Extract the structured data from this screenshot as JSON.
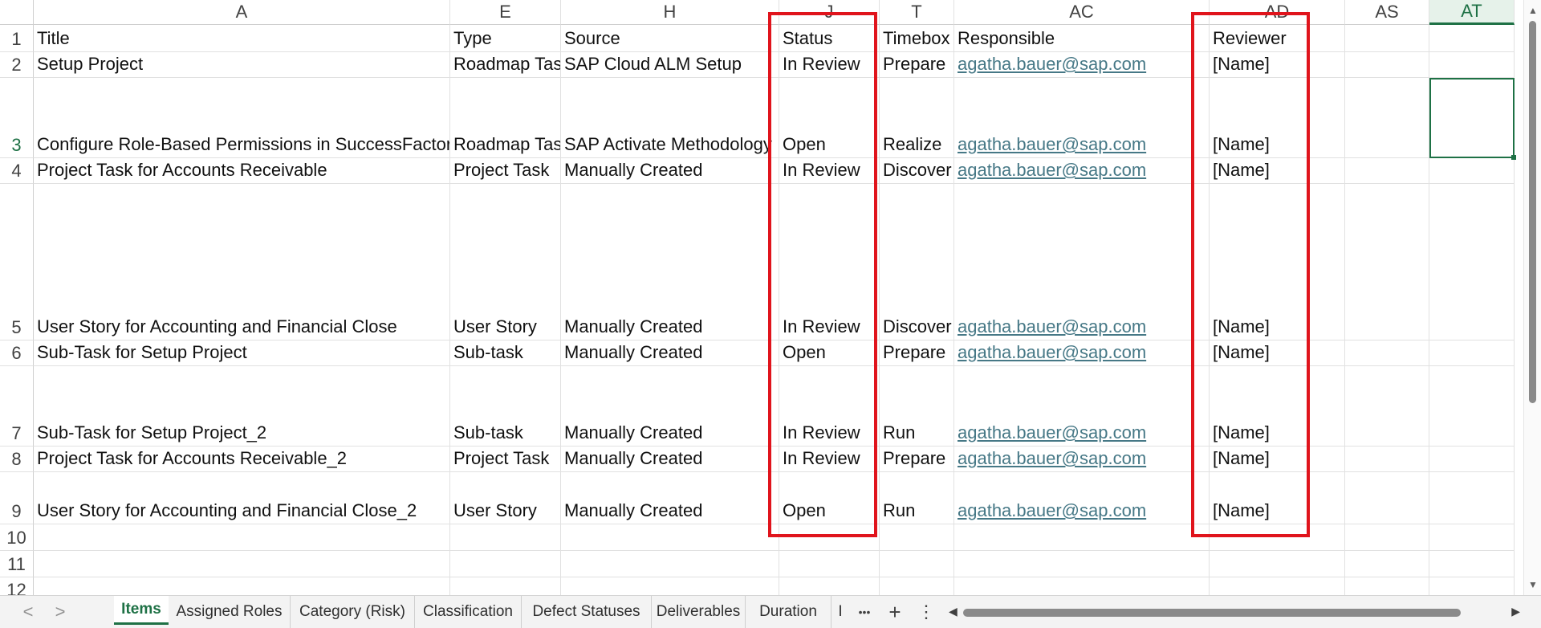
{
  "columns": [
    {
      "label": "A"
    },
    {
      "label": "E"
    },
    {
      "label": "H"
    },
    {
      "label": "J"
    },
    {
      "label": "T"
    },
    {
      "label": "AC"
    },
    {
      "label": "AD"
    },
    {
      "label": "AS"
    },
    {
      "label": "AT"
    }
  ],
  "active_column": "AT",
  "active_row": "3",
  "rows": [
    {
      "num": "1",
      "cells": [
        "Title",
        "Type",
        "Source",
        "Status",
        "Timebox",
        "Responsible",
        "Reviewer",
        "",
        ""
      ]
    },
    {
      "num": "2",
      "cells": [
        "Setup Project",
        "Roadmap Task",
        "SAP Cloud ALM Setup",
        "In Review",
        "Prepare",
        "agatha.bauer@sap.com",
        "[Name]",
        "",
        ""
      ]
    },
    {
      "num": "3",
      "cells": [
        "Configure Role-Based Permissions in SuccessFactors",
        "Roadmap Task",
        "SAP Activate Methodology",
        "Open",
        "Realize",
        "agatha.bauer@sap.com",
        "[Name]",
        "",
        ""
      ]
    },
    {
      "num": "4",
      "cells": [
        "Project Task for Accounts Receivable",
        "Project Task",
        "Manually Created",
        "In Review",
        "Discover",
        "agatha.bauer@sap.com",
        "[Name]",
        "",
        ""
      ]
    },
    {
      "num": "5",
      "cells": [
        "User Story for Accounting and Financial Close",
        "User Story",
        "Manually Created",
        "In Review",
        "Discover",
        "agatha.bauer@sap.com",
        "[Name]",
        "",
        ""
      ]
    },
    {
      "num": "6",
      "cells": [
        "Sub-Task for Setup Project",
        "Sub-task",
        "Manually Created",
        "Open",
        "Prepare",
        "agatha.bauer@sap.com",
        "[Name]",
        "",
        ""
      ]
    },
    {
      "num": "7",
      "cells": [
        "Sub-Task for Setup Project_2",
        "Sub-task",
        "Manually Created",
        "In Review",
        "Run",
        "agatha.bauer@sap.com",
        "[Name]",
        "",
        ""
      ]
    },
    {
      "num": "8",
      "cells": [
        "Project Task for Accounts Receivable_2",
        "Project Task",
        "Manually Created",
        "In Review",
        "Prepare",
        "agatha.bauer@sap.com",
        "[Name]",
        "",
        ""
      ]
    },
    {
      "num": "9",
      "cells": [
        "User Story for Accounting and Financial Close_2",
        "User Story",
        "Manually Created",
        "Open",
        "Run",
        "agatha.bauer@sap.com",
        "[Name]",
        "",
        ""
      ]
    },
    {
      "num": "10",
      "cells": [
        "",
        "",
        "",
        "",
        "",
        "",
        "",
        "",
        ""
      ]
    },
    {
      "num": "11",
      "cells": [
        "",
        "",
        "",
        "",
        "",
        "",
        "",
        "",
        ""
      ]
    },
    {
      "num": "12",
      "cells": [
        "",
        "",
        "",
        "",
        "",
        "",
        "",
        "",
        ""
      ]
    }
  ],
  "tabs": [
    {
      "label": "Items"
    },
    {
      "label": "Assigned Roles"
    },
    {
      "label": "Category (Risk)"
    },
    {
      "label": "Classification"
    },
    {
      "label": "Defect Statuses"
    },
    {
      "label": "Deliverables"
    },
    {
      "label": "Duration"
    },
    {
      "label": "I"
    }
  ],
  "active_tab": "Items",
  "tab_controls": {
    "more": "•••",
    "add": "+",
    "options": "⋮",
    "prev": "<",
    "next": ">"
  },
  "colors": {
    "accent": "#1e7145",
    "highlight_box": "#e0141c",
    "link": "#467886"
  }
}
